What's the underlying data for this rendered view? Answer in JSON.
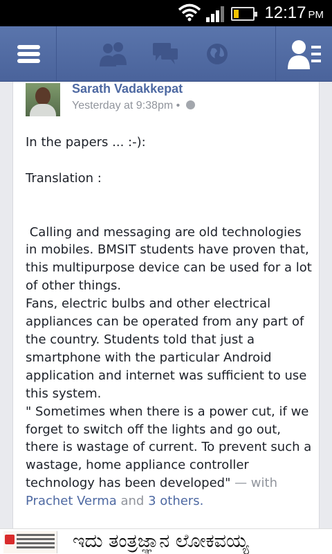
{
  "status_bar": {
    "time": "12:17",
    "ampm": "PM",
    "battery_level": 0.25
  },
  "navbar": {
    "menu_icon": "menu-icon",
    "friends_icon": "friends-icon",
    "messages_icon": "messages-icon",
    "notifications_icon": "globe-icon",
    "friend_requests_icon": "friend-requests-icon"
  },
  "post": {
    "author": "Sarath Vadakkepat",
    "timestamp": "Yesterday at 9:38pm",
    "separator": "•",
    "privacy_icon": "globe-icon",
    "body": "In the papers ... :-):\n\nTranslation :\n\n\n Calling and messaging are old technologies in mobiles. BMSIT students have proven that, this multipurpose device can be used for a lot of other things.\nFans, electric bulbs and other electrical appliances can be operated from any part of the country. Students told that just a smartphone with the particular Android application and internet was sufficient to use this system.\n\" Sometimes when there is a power cut, if we forget to switch off the lights and go out, there is wastage of current. To prevent such a wastage, home appliance controller technology has been developed\"",
    "with_text": " — with",
    "tagged_person": "Prachet Verma",
    "and_text": " and ",
    "others_text": "3 others",
    "end_text": "."
  },
  "ad_banner": {
    "headline": "ಇದು ತಂತ್ರಜ್ಞಾನ ಲೋಕವಯ್ಯ"
  }
}
